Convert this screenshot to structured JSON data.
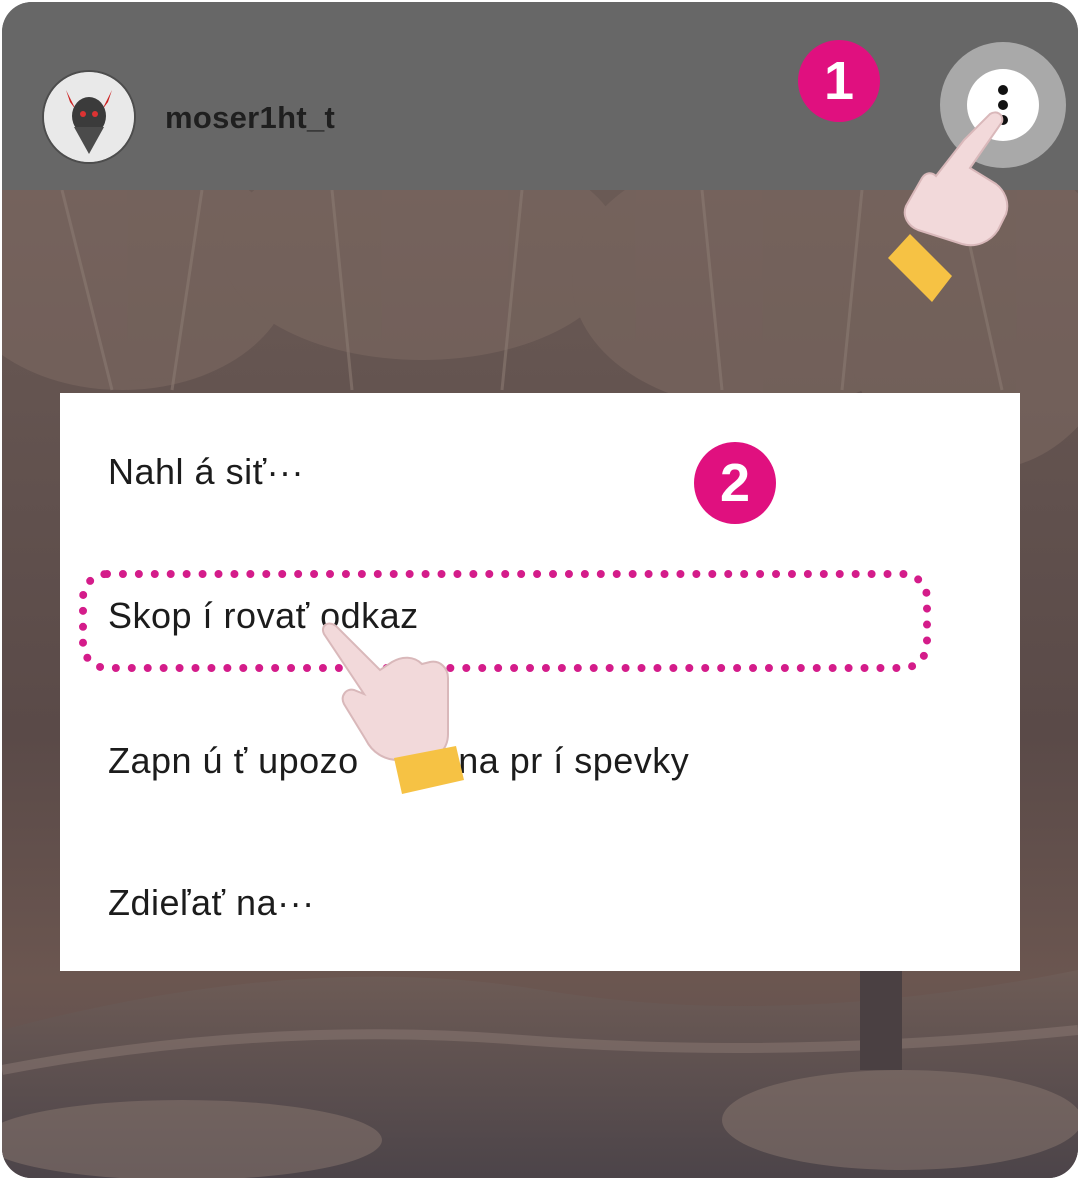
{
  "header": {
    "username": "moser1ht_t",
    "more_icon": "more-vertical-icon"
  },
  "steps": {
    "step1": "1",
    "step2": "2"
  },
  "menu": {
    "items": [
      {
        "label": "Nahl á siť···"
      },
      {
        "label": "Skop í rovať odkaz"
      },
      {
        "label": "Zapn ú ť upozo",
        "label_tail": "ia na pr í spevky"
      },
      {
        "label": "Zdieľať na···"
      }
    ]
  },
  "colors": {
    "accent": "#e0107f",
    "highlight": "#d41c8a",
    "header_bg": "#676767",
    "cuff": "#f6c244"
  }
}
